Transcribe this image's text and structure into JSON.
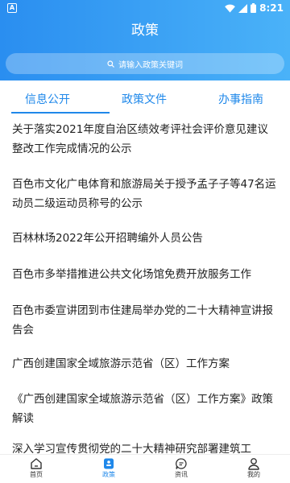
{
  "status_bar": {
    "left_icon": "A",
    "time": "8:21"
  },
  "header": {
    "title": "政策",
    "search": {
      "placeholder": "请输入政策关键词",
      "icon": "search-icon"
    }
  },
  "tabs": [
    {
      "label": "信息公开",
      "active": true
    },
    {
      "label": "政策文件",
      "active": false
    },
    {
      "label": "办事指南",
      "active": false
    }
  ],
  "items": [
    {
      "title": "关于落实2021年度自治区绩效考评社会评价意见建议整改工作完成情况的公示"
    },
    {
      "title": "百色市文化广电体育和旅游局关于授予孟子子等47名运动员二级运动员称号的公示"
    },
    {
      "title": "百林林场2022年公开招聘编外人员公告"
    },
    {
      "title": "百色市多举措推进公共文化场馆免费开放服务工作"
    },
    {
      "title": "百色市委宣讲团到市住建局举办党的二十大精神宣讲报告会"
    },
    {
      "title": "广西创建国家全域旅游示范省（区）工作方案"
    },
    {
      "title": "《广西创建国家全域旅游示范省（区）工作方案》政策解读"
    },
    {
      "title": "深入学习宣传贯彻党的二十大精神研究部署建筑工"
    }
  ],
  "bottom_nav": [
    {
      "label": "首页",
      "icon": "home-icon",
      "active": false
    },
    {
      "label": "政策",
      "icon": "policy-icon",
      "active": true
    },
    {
      "label": "资讯",
      "icon": "chat-icon",
      "active": false
    },
    {
      "label": "我的",
      "icon": "profile-icon",
      "active": false
    }
  ],
  "colors": {
    "accent": "#1f88ea",
    "header_start": "#2a8ef0",
    "header_end": "#4ab2f8"
  }
}
